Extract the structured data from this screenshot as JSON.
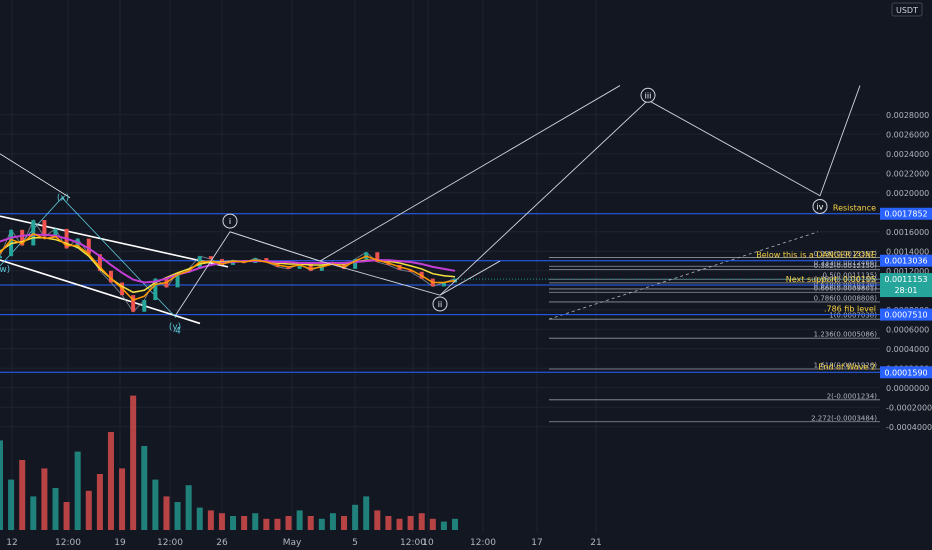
{
  "currency_badge": "USDT",
  "last_price": "0.0011153",
  "countdown": "28:01",
  "colors": {
    "background": "#131722",
    "grid": "#1f2330",
    "axis_text": "#b2b5be",
    "level_line": "#2962ff",
    "level_label_bg": "#2962ff",
    "fib_line": "#b2b5be",
    "annotation_yellow": "#f5d142",
    "wave_path": "#d1d4dc",
    "channel": "#ffffff",
    "candle_up": "#26a69a",
    "candle_down": "#ef5350",
    "last_price_bg": "#26a69a",
    "ma_yellow": "#f5e342",
    "ma_magenta": "#c23ed6",
    "ma_orange": "#ff9800",
    "volume_green": "#26a69a",
    "volume_red": "#ef5350"
  },
  "chart_data": {
    "type": "candlestick",
    "title": "",
    "xlabel": "",
    "ylabel": "",
    "ylim": [
      -0.00045,
      0.0031
    ],
    "x_ticks": [
      "12",
      "12:00",
      "19",
      "12:00",
      "26",
      "May",
      "5",
      "12:00",
      "10",
      "12:00",
      "17",
      "21"
    ],
    "y_ticks": [
      "0.0028000",
      "0.0026000",
      "0.0024000",
      "0.0022000",
      "0.0020000",
      "0.0016000",
      "0.0014000",
      "0.0012000",
      "0.0008000",
      "0.0006000",
      "0.0004000",
      "0.0002000",
      "0.0000000",
      "-0.0002000",
      "-0.0004000"
    ],
    "y_tick_values": [
      0.0028,
      0.0026,
      0.0024,
      0.0022,
      0.002,
      0.0016,
      0.0014,
      0.0012,
      0.0008,
      0.0006,
      0.0004,
      0.0002,
      0.0,
      -0.0002,
      -0.0004
    ],
    "price_path": [
      0.00135,
      0.00162,
      0.00146,
      0.00172,
      0.00155,
      0.00163,
      0.00143,
      0.00153,
      0.00137,
      0.0012,
      0.00108,
      0.00095,
      0.00078,
      0.0009,
      0.00112,
      0.00103,
      0.00118,
      0.00122,
      0.00135,
      0.00132,
      0.00126,
      0.00131,
      0.00128,
      0.00133,
      0.00129,
      0.00124,
      0.00122,
      0.00127,
      0.0012,
      0.00126,
      0.00129,
      0.00122,
      0.00132,
      0.00139,
      0.00129,
      0.00126,
      0.00121,
      0.00119,
      0.00112,
      0.00104,
      0.00108,
      0.00112
    ],
    "moving_averages": [
      {
        "values": [
          0.0014,
          0.00148,
          0.0015,
          0.00154,
          0.00154,
          0.00152,
          0.00148,
          0.00144,
          0.00135,
          0.00122,
          0.00112,
          0.00104,
          0.00098,
          0.001,
          0.00108,
          0.00113,
          0.00118,
          0.00122,
          0.00127,
          0.00129,
          0.00129,
          0.0013,
          0.0013,
          0.0013,
          0.0013,
          0.00128,
          0.00127,
          0.00127,
          0.00126,
          0.00126,
          0.00127,
          0.00127,
          0.00129,
          0.00131,
          0.00131,
          0.0013,
          0.00128,
          0.00125,
          0.00122,
          0.00117,
          0.00115,
          0.00114
        ]
      },
      {
        "values": [
          0.0015,
          0.00154,
          0.00156,
          0.00157,
          0.00157,
          0.00156,
          0.00153,
          0.00149,
          0.00143,
          0.00135,
          0.00126,
          0.00118,
          0.00111,
          0.00108,
          0.00109,
          0.00112,
          0.00116,
          0.00119,
          0.00123,
          0.00126,
          0.00128,
          0.00129,
          0.0013,
          0.0013,
          0.0013,
          0.00129,
          0.00129,
          0.00128,
          0.00128,
          0.00128,
          0.00128,
          0.00128,
          0.00129,
          0.0013,
          0.00131,
          0.00131,
          0.0013,
          0.00129,
          0.00127,
          0.00124,
          0.00122,
          0.0012
        ]
      },
      {
        "values": [
          0.00138,
          0.00152,
          0.00148,
          0.00158,
          0.00153,
          0.00155,
          0.00146,
          0.00146,
          0.00137,
          0.00124,
          0.00112,
          0.00102,
          0.0009,
          0.00094,
          0.00106,
          0.00108,
          0.00116,
          0.0012,
          0.00129,
          0.0013,
          0.00127,
          0.0013,
          0.00129,
          0.00131,
          0.00129,
          0.00126,
          0.00124,
          0.00126,
          0.00122,
          0.00124,
          0.00127,
          0.00124,
          0.0013,
          0.00135,
          0.00131,
          0.00128,
          0.00124,
          0.00121,
          0.00115,
          0.00108,
          0.00108,
          0.0011
        ]
      }
    ],
    "volume": [
      0.32,
      0.18,
      0.25,
      0.12,
      0.22,
      0.15,
      0.1,
      0.28,
      0.14,
      0.2,
      0.35,
      0.22,
      0.48,
      0.3,
      0.18,
      0.12,
      0.1,
      0.16,
      0.08,
      0.07,
      0.06,
      0.05,
      0.05,
      0.06,
      0.04,
      0.04,
      0.05,
      0.07,
      0.05,
      0.04,
      0.06,
      0.05,
      0.09,
      0.12,
      0.07,
      0.05,
      0.04,
      0.05,
      0.06,
      0.04,
      0.03,
      0.04
    ],
    "horizontal_levels": [
      {
        "label": "0.0017852",
        "value": 0.0017852,
        "annotation": "Resistance"
      },
      {
        "label": "0.0013036",
        "value": 0.0013036,
        "annotation": "Below this is a DANGER ZONE"
      },
      {
        "label": "0.0010547",
        "value": 0.0010547,
        "annotation": "Next support: 0.00105"
      },
      {
        "label": "0.0007510",
        "value": 0.000751,
        "annotation": ".786 fib level"
      },
      {
        "label": "0.0001590",
        "value": 0.000159,
        "annotation": "End of Wave 2"
      }
    ],
    "fib_levels": [
      {
        "label": "0.236(0.0013357)",
        "value": 0.0013357
      },
      {
        "label": "0.333(0.0012466)",
        "value": 0.0012466
      },
      {
        "label": "0.382(0.0012150)",
        "value": 0.001215
      },
      {
        "label": "0.5(0.0011135)",
        "value": 0.0011135
      },
      {
        "label": "0.559(0.0010759)",
        "value": 0.0010759
      },
      {
        "label": "0.618(0.0010138)",
        "value": 0.0010138
      },
      {
        "label": "0.666(0.0009801)",
        "value": 0.0009801
      },
      {
        "label": "0.786(0.0008808)",
        "value": 0.0008808
      },
      {
        "label": "1(0.0007038)",
        "value": 0.0007038
      },
      {
        "label": "1.236(0.0005086)",
        "value": 0.0005086
      },
      {
        "label": "1.618(0.0001926)",
        "value": 0.0001926
      },
      {
        "label": "2(-0.0001234)",
        "value": -0.0001234
      },
      {
        "label": "2.272(-0.0003484)",
        "value": -0.0003484
      }
    ],
    "wave_labels": [
      {
        "text": "(x)",
        "value": 0.00195
      },
      {
        "text": "(y)",
        "value": 0.00063
      },
      {
        "text": "(w)",
        "value": 0.00122
      },
      {
        "text": "4",
        "value": 0.00059
      },
      {
        "text": "i",
        "value": 0.00171
      },
      {
        "text": "ii",
        "value": 0.00086
      },
      {
        "text": "iii",
        "value": 0.003
      },
      {
        "text": "iv",
        "value": 0.00186
      }
    ],
    "wave_path": [
      0.00075,
      0.0016,
      0.0013,
      0.00095,
      0.00295,
      0.00197,
      0.0031
    ],
    "grid": true
  }
}
